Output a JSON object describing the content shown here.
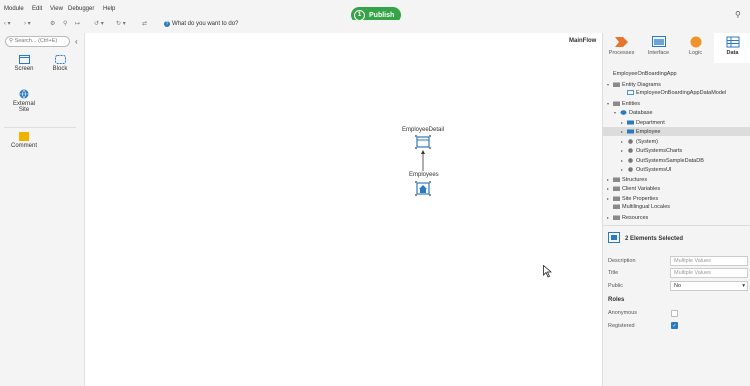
{
  "menu": {
    "items": [
      "Module",
      "Edit",
      "View",
      "Debugger",
      "Help"
    ]
  },
  "publish": {
    "number": "1",
    "label": "Publish"
  },
  "toolbar": {
    "ask_prompt": "What do you want to do?"
  },
  "toolbox": {
    "search_placeholder": "Search... (Ctrl+E)",
    "tools": [
      {
        "label": "Screen",
        "icon": "screen-icon"
      },
      {
        "label": "Block",
        "icon": "block-icon"
      },
      {
        "label": "External Site",
        "icon": "globe-icon"
      },
      {
        "label": "Comment",
        "icon": "comment-icon"
      }
    ]
  },
  "canvas": {
    "flow_name": "MainFlow",
    "nodes": [
      {
        "label": "EmployeeDetail",
        "icon": "screen-node-icon"
      },
      {
        "label": "Employees",
        "icon": "home-screen-node-icon"
      }
    ]
  },
  "right_tabs": [
    {
      "label": "Processes",
      "icon": "processes-icon"
    },
    {
      "label": "Interface",
      "icon": "interface-icon"
    },
    {
      "label": "Logic",
      "icon": "logic-icon"
    },
    {
      "label": "Data",
      "icon": "data-icon",
      "active": true
    }
  ],
  "tree": [
    {
      "label": "EmployeeOnBoardingApp",
      "depth": 0,
      "arrow": "",
      "icon": "app-icon"
    },
    {
      "label": "Entity Diagrams",
      "depth": 0,
      "arrow": "down",
      "icon": "folder-icon"
    },
    {
      "label": "EmployeeOnBoardingAppDataModel",
      "depth": 2,
      "arrow": "",
      "icon": "diagram-icon"
    },
    {
      "label": "Entities",
      "depth": 0,
      "arrow": "down",
      "icon": "folder-icon"
    },
    {
      "label": "Database",
      "depth": 1,
      "arrow": "down",
      "icon": "database-icon"
    },
    {
      "label": "Department",
      "depth": 2,
      "arrow": "right",
      "icon": "entity-icon"
    },
    {
      "label": "Employee",
      "depth": 2,
      "arrow": "right",
      "icon": "entity-icon",
      "selected": true
    },
    {
      "label": "(System)",
      "depth": 2,
      "arrow": "right",
      "icon": "module-icon"
    },
    {
      "label": "OutSystemsCharts",
      "depth": 2,
      "arrow": "right",
      "icon": "module-icon"
    },
    {
      "label": "OutSystemsSampleDataDB",
      "depth": 2,
      "arrow": "right",
      "icon": "module-icon"
    },
    {
      "label": "OutSystemsUI",
      "depth": 2,
      "arrow": "right",
      "icon": "module-icon"
    },
    {
      "label": "Structures",
      "depth": 0,
      "arrow": "right",
      "icon": "folder-icon"
    },
    {
      "label": "Client Variables",
      "depth": 0,
      "arrow": "right",
      "icon": "folder-icon"
    },
    {
      "label": "Site Properties",
      "depth": 0,
      "arrow": "right",
      "icon": "folder-icon"
    },
    {
      "label": "Multilingual Locales",
      "depth": 0,
      "arrow": "",
      "icon": "folder-icon"
    },
    {
      "label": "Resources",
      "depth": 0,
      "arrow": "right",
      "icon": "folder-icon"
    }
  ],
  "properties": {
    "header": "2 Elements Selected",
    "fields": [
      {
        "label": "Description",
        "value": "Multiple Values"
      },
      {
        "label": "Title",
        "value": "Multiple Values"
      },
      {
        "label": "Public",
        "value": "No"
      }
    ],
    "roles_header": "Roles",
    "roles": [
      {
        "label": "Anonymous",
        "checked": false
      },
      {
        "label": "Registered",
        "checked": true
      }
    ]
  }
}
